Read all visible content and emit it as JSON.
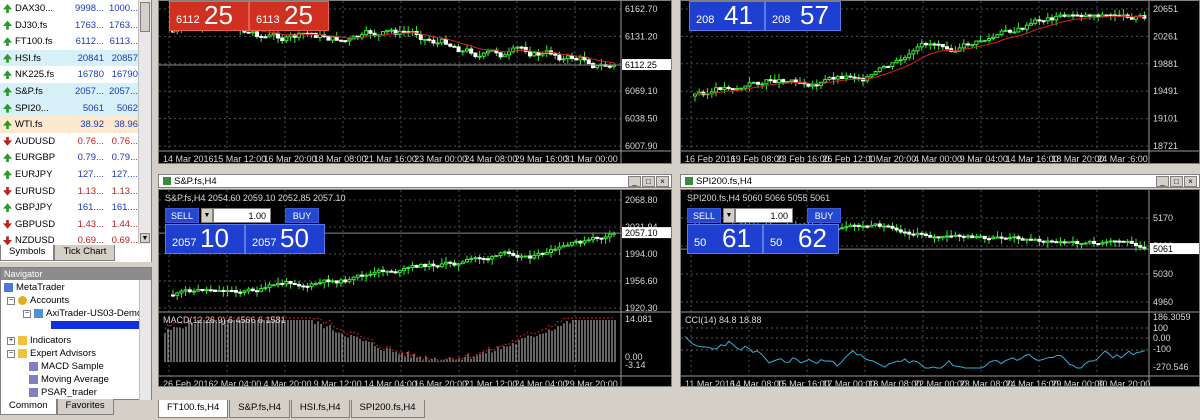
{
  "market_watch": {
    "rows": [
      {
        "symbol": "DAX30...",
        "bid": "9998...",
        "ask": "1000...",
        "dir": "up",
        "bg": "#fff"
      },
      {
        "symbol": "DJ30.fs",
        "bid": "1763...",
        "ask": "1763...",
        "dir": "up",
        "bg": "#fff"
      },
      {
        "symbol": "FT100.fs",
        "bid": "6112...",
        "ask": "6113...",
        "dir": "up",
        "bg": "#fff"
      },
      {
        "symbol": "HSI.fs",
        "bid": "20841",
        "ask": "20857",
        "dir": "up",
        "bg": "#d8f0f8"
      },
      {
        "symbol": "NK225.fs",
        "bid": "16780",
        "ask": "16790",
        "dir": "up",
        "bg": "#fff"
      },
      {
        "symbol": "S&P.fs",
        "bid": "2057...",
        "ask": "2057...",
        "dir": "up",
        "bg": "#d8f0f8"
      },
      {
        "symbol": "SPI20...",
        "bid": "5061",
        "ask": "5062",
        "dir": "up",
        "bg": "#d8f0f8"
      },
      {
        "symbol": "WTI.fs",
        "bid": "38.92",
        "ask": "38.96",
        "dir": "up",
        "bg": "#fde8d0"
      },
      {
        "symbol": "AUDUSD",
        "bid": "0.76...",
        "ask": "0.76...",
        "dir": "dn",
        "bg": "#fff"
      },
      {
        "symbol": "EURGBP",
        "bid": "0.79...",
        "ask": "0.79...",
        "dir": "up",
        "bg": "#fff"
      },
      {
        "symbol": "EURJPY",
        "bid": "127....",
        "ask": "127....",
        "dir": "up",
        "bg": "#fff"
      },
      {
        "symbol": "EURUSD",
        "bid": "1.13...",
        "ask": "1.13...",
        "dir": "dn",
        "bg": "#fff"
      },
      {
        "symbol": "GBPJPY",
        "bid": "161....",
        "ask": "161....",
        "dir": "up",
        "bg": "#fff"
      },
      {
        "symbol": "GBPUSD",
        "bid": "1.43...",
        "ask": "1.44...",
        "dir": "dn",
        "bg": "#fff"
      },
      {
        "symbol": "NZDUSD",
        "bid": "0.69...",
        "ask": "0.69...",
        "dir": "dn",
        "bg": "#fff"
      }
    ],
    "tabs": [
      "Symbols",
      "Tick Chart"
    ]
  },
  "navigator": {
    "title": "Navigator",
    "items": [
      "MetaTrader",
      "Accounts",
      "AxiTrader-US03-Demo",
      "Indicators",
      "Expert Advisors",
      "MACD Sample",
      "Moving Average",
      "PSAR_trader"
    ],
    "tabs": [
      "Common",
      "Favorites"
    ]
  },
  "charts": {
    "ft100": {
      "sell_small": "6112",
      "sell_big": "25",
      "buy_small": "6113",
      "buy_big": "25",
      "price_axis": [
        "6162.70",
        "6131.20",
        "6100.60",
        "6069.10",
        "6038.50",
        "6007.90"
      ],
      "last_price": "6112.25",
      "time_axis": [
        "14 Mar 2016",
        "15 Mar 12:00",
        "16 Mar 20:00",
        "18 Mar 08:00",
        "21 Mar 16:00",
        "23 Mar 00:00",
        "24 Mar 08:00",
        "29 Mar 16:00",
        "31 Mar 00:00"
      ]
    },
    "hsi": {
      "sell_small": "208",
      "sell_big": "41",
      "buy_small": "208",
      "buy_big": "57",
      "price_axis": [
        "20651",
        "20261",
        "19881",
        "19491",
        "19101",
        "18721"
      ],
      "time_axis": [
        "16 Feb 2016",
        "19 Feb 08:00",
        "23 Feb 16:00",
        "26 Feb 12:00",
        "1 Mar 20:00",
        "4 Mar 00:00",
        "9 Mar 04:00",
        "14 Mar 16:00",
        "18 Mar 20:00",
        "24 Mar :6:00"
      ]
    },
    "sp": {
      "title": "S&P.fs,H4",
      "ohlc": "S&P.fs,H4  2054.60 2059.10 2052.85 2057.10",
      "sell_label": "SELL",
      "buy_label": "BUY",
      "volume": "1.00",
      "sell_small": "2057",
      "sell_big": "10",
      "buy_small": "2057",
      "buy_big": "50",
      "price_axis": [
        "2068.80",
        "2031.94",
        "1994.00",
        "1956.60",
        "1920.30"
      ],
      "last_price": "2057.10",
      "macd_label": "MACD(12,26,9) 6.4566 6.1581",
      "macd_axis": [
        "14.081",
        "0.00",
        "-3.14"
      ],
      "time_axis": [
        "26 Feb 2016",
        "2 Mar 04:00",
        "4 Mar 20:00",
        "9 Mar 12:00",
        "14 Mar 04:00",
        "16 Mar 20:00",
        "21 Mar 12:00",
        "24 Mar 04:00",
        "29 Mar 20:00"
      ]
    },
    "spi": {
      "title": "SPI200.fs,H4",
      "ohlc": "SPI200.fs,H4  5060 5066 5055 5061",
      "sell_label": "SELL",
      "buy_label": "BUY",
      "volume": "1.00",
      "sell_small": "50",
      "sell_big": "61",
      "buy_small": "50",
      "buy_big": "62",
      "price_axis": [
        "5170",
        "5100",
        "5030",
        "4960"
      ],
      "last_price": "5061",
      "cci_label": "CCI(14) 84.8 18.88",
      "cci_axis": [
        "186.3059",
        "100",
        "0.00",
        "-100",
        "-270.546"
      ],
      "time_axis": [
        "11 Mar 2016",
        "14 Mar 08:00",
        "15 Mar 16:00",
        "17 Mar 00:00",
        "18 Mar 08:00",
        "22 Mar 00:00",
        "23 Mar 08:00",
        "24 Mar 16:00",
        "29 Mar 00:00",
        "30 Mar 20:00"
      ]
    }
  },
  "chart_tabs": [
    "FT100.fs,H4",
    "S&P.fs,H4",
    "HSI.fs,H4",
    "SPI200.fs,H4"
  ]
}
